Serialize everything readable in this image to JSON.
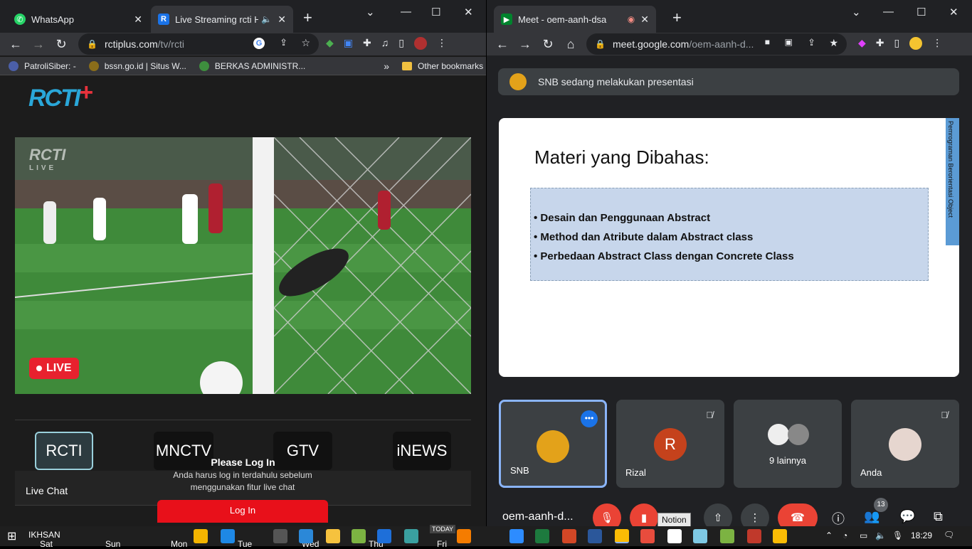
{
  "left_window": {
    "tabs": [
      {
        "title": "WhatsApp",
        "icon": "whatsapp-icon"
      },
      {
        "title": "Live Streaming rcti Ha",
        "icon": "rcti-icon"
      }
    ],
    "url_host": "rctiplus.com",
    "url_path": "/tv/rcti",
    "bookmarks": [
      "PatroliSiber: -",
      "bssn.go.id | Situs W...",
      "BERKAS ADMINISTR...",
      "Other bookmarks"
    ],
    "page": {
      "logo": "RCTI",
      "watermark": "RCTI",
      "watermark_sub": "LIVE",
      "live_badge": "LIVE",
      "channels": [
        "RCTI",
        "MNCTV",
        "GTV",
        "iNEWS"
      ],
      "live_chat_label": "Live Chat",
      "login_title": "Please Log In",
      "login_desc": "Anda harus log in terdahulu sebelum menggunakan fitur live chat",
      "login_button": "Log In"
    }
  },
  "right_window": {
    "tabs": [
      {
        "title": "Meet - oem-aanh-dsa",
        "icon": "meet-icon"
      }
    ],
    "url_host": "meet.google.com",
    "url_path": "/oem-aanh-d...",
    "presenting_text": "SNB sedang melakukan presentasi",
    "slide": {
      "title": "Materi yang Dibahas:",
      "bullets": [
        "Desain dan Penggunaan Abstract",
        "Method dan Atribute dalam Abstract class",
        "Perbedaan Abstract Class dengan Concrete Class"
      ],
      "side_label": "Pemrograman Berorientasi Object"
    },
    "participants": [
      {
        "name": "SNB"
      },
      {
        "name": "Rizal",
        "initial": "R"
      },
      {
        "name": "9 lainnya"
      },
      {
        "name": "Anda"
      }
    ],
    "meeting_code": "oem-aanh-d...",
    "tooltip": "Notion",
    "people_count": "13"
  },
  "taskbar": {
    "user": "IKHSAN",
    "days": [
      "Sat",
      "Sun",
      "Mon",
      "Tue",
      "Wed",
      "Thu",
      "Fri"
    ],
    "today_label": "TODAY",
    "time": "18:29"
  },
  "colors": {
    "live_red": "#e8212e",
    "meet_red": "#ea4335",
    "accent_blue": "#8ab4f8"
  }
}
